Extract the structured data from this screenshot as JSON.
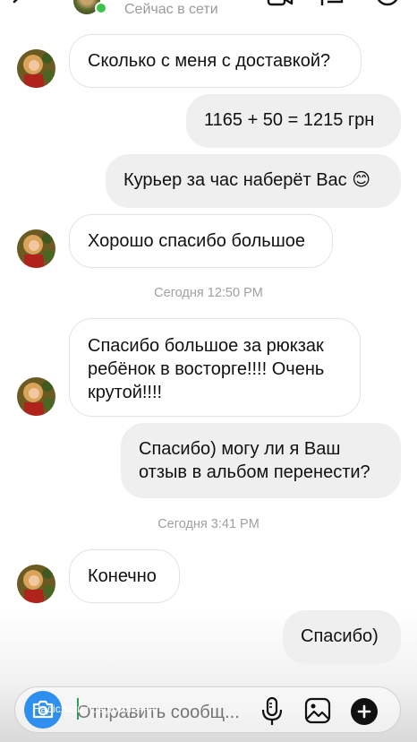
{
  "header": {
    "status": "Сейчас в сети",
    "online_color": "#3cc44a"
  },
  "messages": [
    {
      "direction": "incoming",
      "text": "Сколько с меня с доставкой?"
    },
    {
      "direction": "outgoing",
      "text": "1165 + 50 = 1215 грн"
    },
    {
      "direction": "outgoing",
      "text": "Курьер за час наберёт Вас 😊"
    },
    {
      "direction": "incoming",
      "text": "Хорошо спасибо большое"
    },
    {
      "direction": "timestamp",
      "text": "Сегодня 12:50 PM"
    },
    {
      "direction": "incoming",
      "text": "Спасибо большое за рюкзак\nребёнок в восторге!!!! Очень\nкрутой!!!!"
    },
    {
      "direction": "outgoing",
      "text": "Спасибо) могу ли я Ваш\nотзыв в альбом перенести?"
    },
    {
      "direction": "timestamp",
      "text": "Сегодня 3:41 PM"
    },
    {
      "direction": "incoming",
      "text": "Конечно"
    },
    {
      "direction": "outgoing",
      "text": "Спасибо)"
    }
  ],
  "composer": {
    "placeholder": "Отправить сообщ...",
    "overlay_text": "Надіслати повідомлення",
    "camera_color": "#2e8ff0"
  },
  "icons": {
    "back": "back-arrow-icon",
    "video": "video-call-icon",
    "flag": "flag-icon",
    "info": "info-icon",
    "camera": "camera-icon",
    "mic": "microphone-icon",
    "gallery": "gallery-icon",
    "plus": "plus-icon"
  }
}
